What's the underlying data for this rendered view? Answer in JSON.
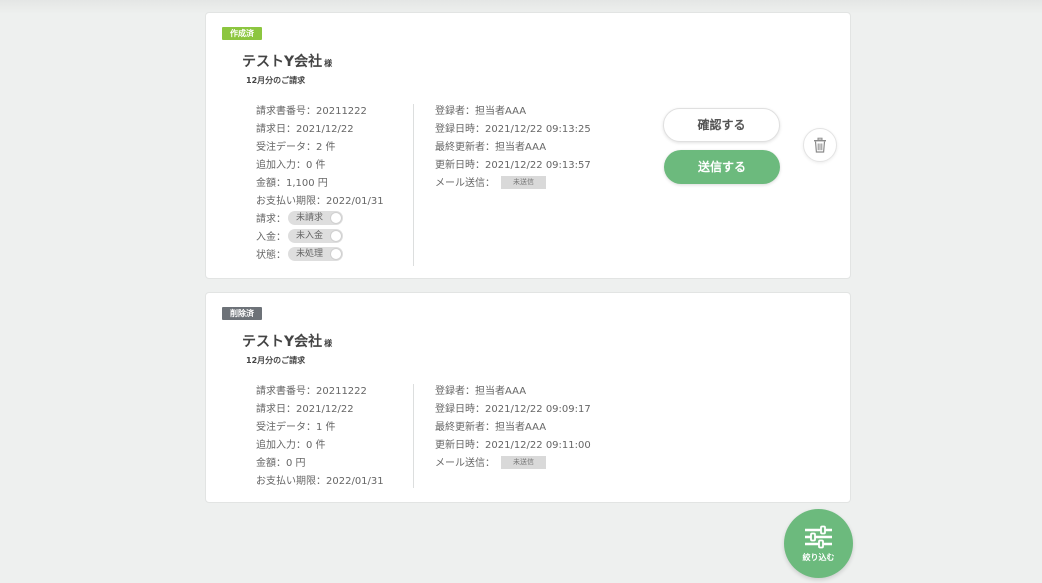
{
  "colors": {
    "accent_green": "#6cba7d",
    "tag_created": "#8cc63f",
    "tag_deleted": "#6d7278"
  },
  "cards": [
    {
      "status_tag": "作成済",
      "company": "テストY会社",
      "honorific": "様",
      "period": "12月分のご請求",
      "details": [
        {
          "label": "請求書番号：",
          "value": "20211222"
        },
        {
          "label": "請求日：",
          "value": "2021/12/22"
        },
        {
          "label": "受注データ：",
          "value": "2 件"
        },
        {
          "label": "追加入力：",
          "value": "0 件"
        },
        {
          "label": "金額：",
          "value": "1,100 円"
        },
        {
          "label": "お支払い期限：",
          "value": "2022/01/31"
        }
      ],
      "toggles": [
        {
          "label": "請求：",
          "value": "未請求"
        },
        {
          "label": "入金：",
          "value": "未入金"
        },
        {
          "label": "状態：",
          "value": "未処理"
        }
      ],
      "meta": [
        {
          "label": "登録者：",
          "value": "担当者AAA"
        },
        {
          "label": "登録日時：",
          "value": "2021/12/22 09:13:25"
        },
        {
          "label": "最終更新者：",
          "value": "担当者AAA"
        },
        {
          "label": "更新日時：",
          "value": "2021/12/22 09:13:57"
        }
      ],
      "mail_label": "メール送信：",
      "mail_status": "未送信",
      "confirm_label": "確認する",
      "send_label": "送信する",
      "delete_icon": "trash-icon"
    },
    {
      "status_tag": "削除済",
      "company": "テストY会社",
      "honorific": "様",
      "period": "12月分のご請求",
      "details": [
        {
          "label": "請求書番号：",
          "value": "20211222"
        },
        {
          "label": "請求日：",
          "value": "2021/12/22"
        },
        {
          "label": "受注データ：",
          "value": "1 件"
        },
        {
          "label": "追加入力：",
          "value": "0 件"
        },
        {
          "label": "金額：",
          "value": "0 円"
        },
        {
          "label": "お支払い期限：",
          "value": "2022/01/31"
        }
      ],
      "meta": [
        {
          "label": "登録者：",
          "value": "担当者AAA"
        },
        {
          "label": "登録日時：",
          "value": "2021/12/22 09:09:17"
        },
        {
          "label": "最終更新者：",
          "value": "担当者AAA"
        },
        {
          "label": "更新日時：",
          "value": "2021/12/22 09:11:00"
        }
      ],
      "mail_label": "メール送信：",
      "mail_status": "未送信"
    }
  ],
  "filter_button": {
    "label": "絞り込む",
    "icon": "sliders-icon"
  }
}
